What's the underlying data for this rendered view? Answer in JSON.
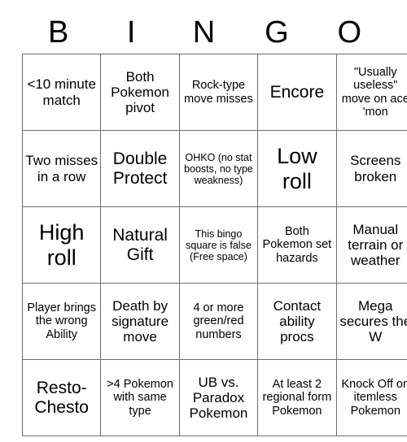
{
  "card": {
    "header_letters": [
      "B",
      "I",
      "N",
      "G",
      "O"
    ],
    "rows": [
      [
        {
          "text": "<10 minute match",
          "size": "md"
        },
        {
          "text": "Both Pokemon pivot",
          "size": "md"
        },
        {
          "text": "Rock-type move misses",
          "size": "sm"
        },
        {
          "text": "Encore",
          "size": "lg"
        },
        {
          "text": "\"Usually useless\" move on ace 'mon",
          "size": "sm"
        }
      ],
      [
        {
          "text": "Two misses in a row",
          "size": "md"
        },
        {
          "text": "Double Protect",
          "size": "lg"
        },
        {
          "text": "OHKO (no stat boosts, no type weakness)",
          "size": "xs"
        },
        {
          "text": "Low roll",
          "size": "xl"
        },
        {
          "text": "Screens broken",
          "size": "md"
        }
      ],
      [
        {
          "text": "High roll",
          "size": "xl"
        },
        {
          "text": "Natural Gift",
          "size": "lg"
        },
        {
          "text": "This bingo square is false (Free space)",
          "size": "xs"
        },
        {
          "text": "Both Pokemon set hazards",
          "size": "sm"
        },
        {
          "text": "Manual terrain or weather",
          "size": "md"
        }
      ],
      [
        {
          "text": "Player brings the wrong Ability",
          "size": "sm"
        },
        {
          "text": "Death by signature move",
          "size": "md"
        },
        {
          "text": "4 or more green/red numbers",
          "size": "sm"
        },
        {
          "text": "Contact ability procs",
          "size": "md"
        },
        {
          "text": "Mega secures the W",
          "size": "md"
        }
      ],
      [
        {
          "text": "Resto-Chesto",
          "size": "lg"
        },
        {
          "text": ">4 Pokemon with same type",
          "size": "sm"
        },
        {
          "text": "UB vs. Paradox Pokemon",
          "size": "md"
        },
        {
          "text": "At least 2 regional form Pokemon",
          "size": "sm"
        },
        {
          "text": "Knock Off on itemless Pokemon",
          "size": "sm"
        }
      ]
    ]
  }
}
